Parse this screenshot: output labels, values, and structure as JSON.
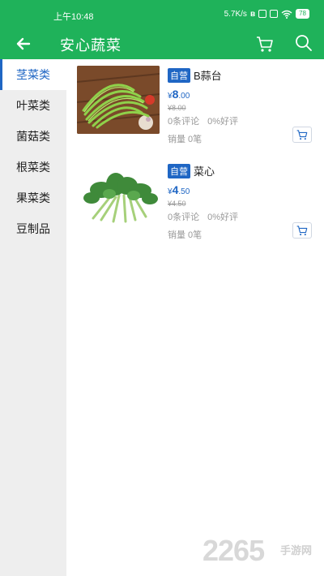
{
  "status": {
    "time": "上午10:48",
    "speed": "5.7K/s",
    "battery": "78"
  },
  "header": {
    "title": "安心蔬菜"
  },
  "sidebar": {
    "items": [
      {
        "label": "茎菜类",
        "active": true
      },
      {
        "label": "叶菜类"
      },
      {
        "label": "菌菇类"
      },
      {
        "label": "根菜类"
      },
      {
        "label": "果菜类"
      },
      {
        "label": "豆制品"
      }
    ]
  },
  "products": [
    {
      "badge": "自营",
      "name": "B蒜台",
      "currency": "¥",
      "price_int": "8",
      "price_dec": ".00",
      "old_price": "¥8.00",
      "reviews": "0条评论",
      "rating": "0%好评",
      "sales": "销量 0笔"
    },
    {
      "badge": "自营",
      "name": "菜心",
      "currency": "¥",
      "price_int": "4",
      "price_dec": ".50",
      "old_price": "¥4.50",
      "reviews": "0条评论",
      "rating": "0%好评",
      "sales": "销量 0笔"
    }
  ],
  "watermark": {
    "text": "2265",
    "sub": "手游网"
  },
  "colors": {
    "brand_green": "#1fb25a",
    "accent_blue": "#1f66c4"
  }
}
